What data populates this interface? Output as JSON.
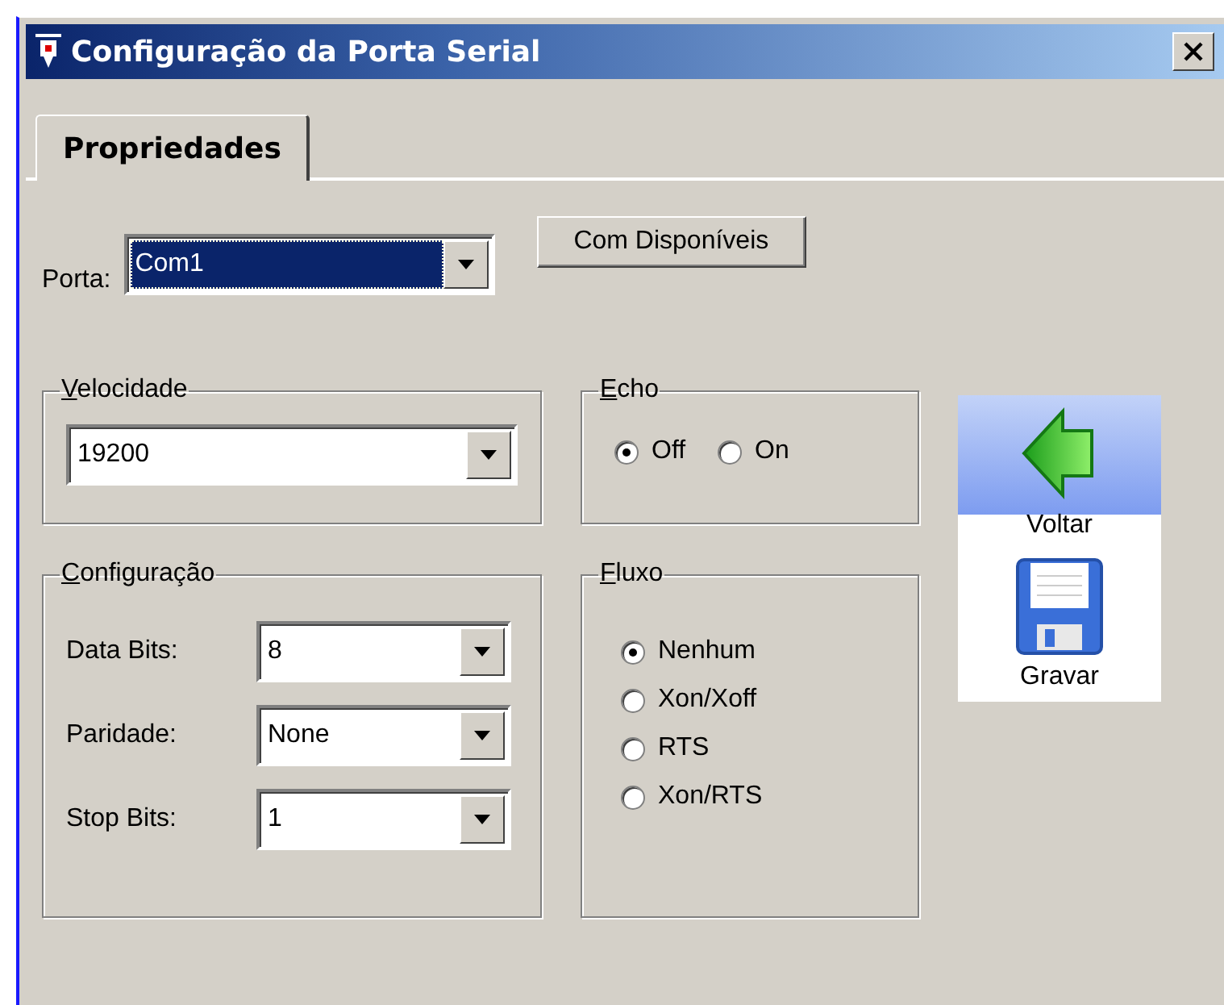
{
  "window": {
    "title": "Configuração da Porta Serial"
  },
  "tabs": [
    {
      "label": "Propriedades",
      "selected": true
    }
  ],
  "porta": {
    "label": "Porta:",
    "value": "Com1",
    "focused": true
  },
  "com_button": "Com Disponíveis",
  "velocidade": {
    "title": "Velocidade",
    "value": "19200"
  },
  "configuracao": {
    "title": "Configuração",
    "fields": [
      {
        "label": "Data Bits:",
        "value": "8"
      },
      {
        "label": "Paridade:",
        "value": "None"
      },
      {
        "label": "Stop Bits:",
        "value": "1"
      }
    ]
  },
  "echo": {
    "title": "Echo",
    "options": [
      {
        "label": "Off",
        "selected": true
      },
      {
        "label": "On",
        "selected": false
      }
    ]
  },
  "fluxo": {
    "title": "Fluxo",
    "options": [
      {
        "label": "Nenhum",
        "selected": true
      },
      {
        "label": "Xon/Xoff",
        "selected": false
      },
      {
        "label": "RTS",
        "selected": false
      },
      {
        "label": "Xon/RTS",
        "selected": false
      }
    ]
  },
  "toolbar": [
    {
      "label": "Voltar",
      "kind": "back",
      "selected": true
    },
    {
      "label": "Gravar",
      "kind": "save",
      "selected": false
    }
  ]
}
